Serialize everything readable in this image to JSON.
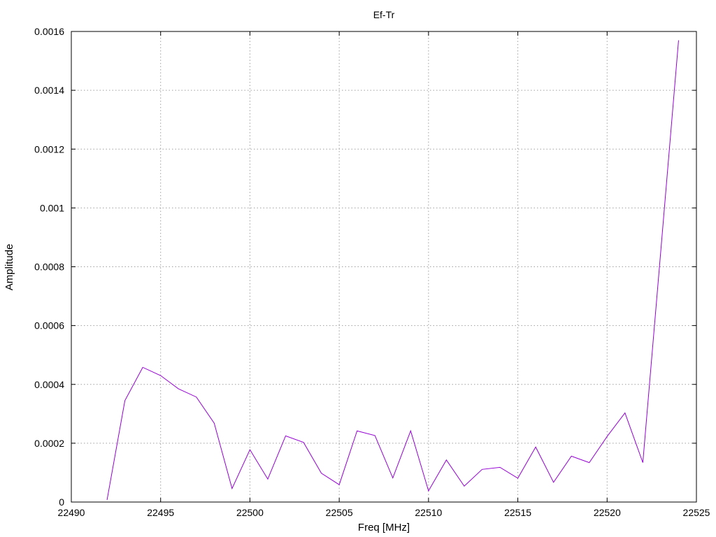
{
  "chart_data": {
    "type": "line",
    "title": "Ef-Tr",
    "xlabel": "Freq [MHz]",
    "ylabel": "Amplitude",
    "xlim": [
      22490,
      22525
    ],
    "ylim": [
      0,
      0.0016
    ],
    "xticks": [
      22490,
      22495,
      22500,
      22505,
      22510,
      22515,
      22520,
      22525
    ],
    "yticks": [
      0,
      0.0002,
      0.0004,
      0.0006,
      0.0008,
      0.001,
      0.0012,
      0.0014,
      0.0016
    ],
    "xtick_labels": [
      "22490",
      "22495",
      "22500",
      "22505",
      "22510",
      "22515",
      "22520",
      "22525"
    ],
    "ytick_labels": [
      "0",
      "0.0002",
      "0.0004",
      "0.0006",
      "0.0008",
      "0.001",
      "0.0012",
      "0.0014",
      "0.0016"
    ],
    "grid": true,
    "series": [
      {
        "color": "#9400d3",
        "x": [
          22492,
          22493,
          22494,
          22495,
          22496,
          22497,
          22498,
          22499,
          22500,
          22501,
          22502,
          22503,
          22504,
          22505,
          22506,
          22507,
          22508,
          22509,
          22510,
          22511,
          22512,
          22513,
          22514,
          22515,
          22516,
          22517,
          22518,
          22519,
          22520,
          22521,
          22522,
          22523,
          22524
        ],
        "y": [
          7e-06,
          0.000345,
          0.000458,
          0.00043,
          0.000385,
          0.000357,
          0.000268,
          4.6e-05,
          0.000178,
          7.8e-05,
          0.000225,
          0.000203,
          9.8e-05,
          5.9e-05,
          0.000242,
          0.000226,
          8.2e-05,
          0.000242,
          3.8e-05,
          0.000143,
          5.4e-05,
          0.000111,
          0.000118,
          8.1e-05,
          0.000187,
          6.7e-05,
          0.000156,
          0.000134,
          0.000223,
          0.000303,
          0.000134,
          0.00085,
          0.00157
        ]
      }
    ]
  }
}
